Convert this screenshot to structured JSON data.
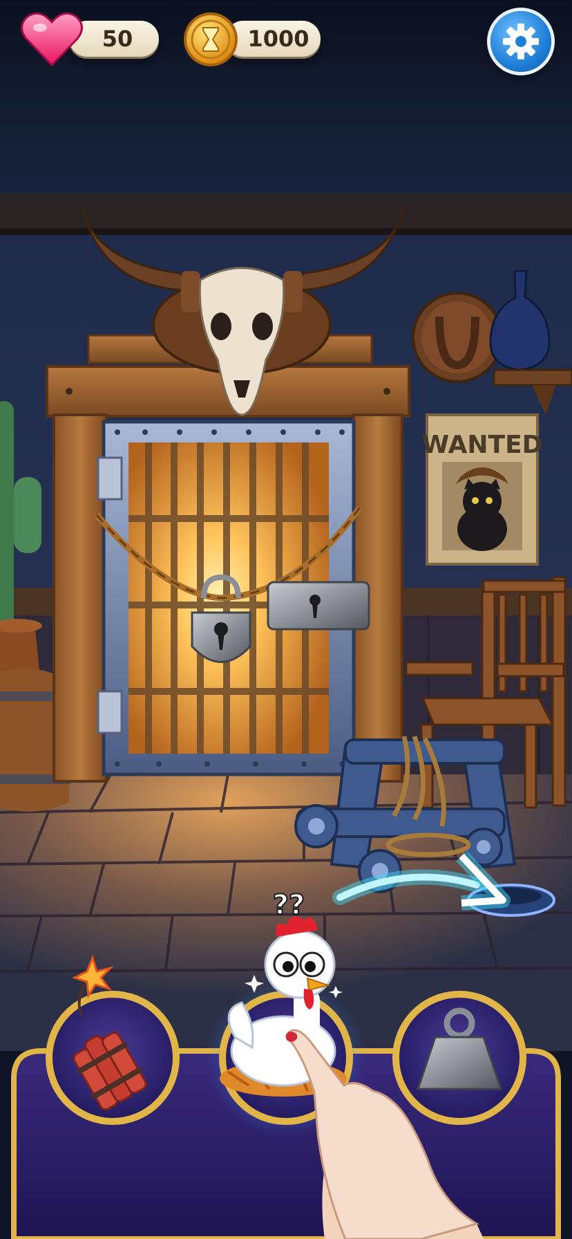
{
  "hud": {
    "lives": {
      "value": "50",
      "icon": "heart-icon"
    },
    "coins": {
      "value": "1000",
      "icon": "hourglass-coin-icon"
    },
    "settings": {
      "icon": "gear-icon"
    }
  },
  "scene": {
    "poster_text": "WANTED",
    "hint_marks": "??"
  },
  "tray": {
    "items": [
      {
        "id": "dynamite",
        "icon": "dynamite-icon"
      },
      {
        "id": "chicken",
        "icon": "chicken-icon",
        "highlighted": true
      },
      {
        "id": "weight",
        "icon": "weight-icon"
      }
    ]
  },
  "colors": {
    "accent_gold": "#e2b548",
    "tray_purple": "#2b1f6b",
    "settings_blue": "#1f7fd8",
    "heart_pink": "#ff3d7f",
    "hint_arrow": "#bff6ff"
  }
}
